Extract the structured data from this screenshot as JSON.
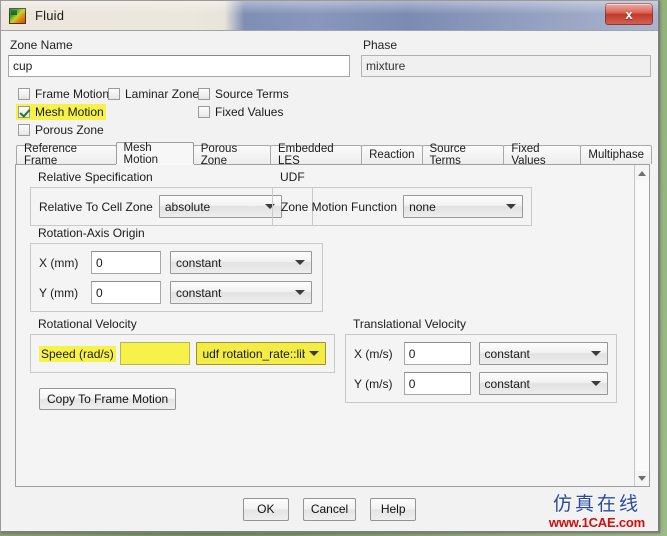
{
  "window": {
    "title": "Fluid",
    "icon": "fluent-app-icon",
    "close_label": "x"
  },
  "header": {
    "zone_name_label": "Zone Name",
    "zone_name_value": "cup",
    "phase_label": "Phase",
    "phase_value": "mixture"
  },
  "checkboxes": [
    {
      "label": "Frame Motion",
      "checked": false,
      "highlighted": false
    },
    {
      "label": "Laminar Zone",
      "checked": false,
      "highlighted": false
    },
    {
      "label": "Source Terms",
      "checked": false,
      "highlighted": false
    },
    {
      "label": "Mesh Motion",
      "checked": true,
      "highlighted": true
    },
    {
      "label": "Fixed Values",
      "checked": false,
      "highlighted": false
    },
    {
      "label": "Porous Zone",
      "checked": false,
      "highlighted": false
    }
  ],
  "tabs": [
    {
      "label": "Reference Frame",
      "active": false
    },
    {
      "label": "Mesh Motion",
      "active": true
    },
    {
      "label": "Porous Zone",
      "active": false
    },
    {
      "label": "Embedded LES",
      "active": false
    },
    {
      "label": "Reaction",
      "active": false
    },
    {
      "label": "Source Terms",
      "active": false
    },
    {
      "label": "Fixed Values",
      "active": false
    },
    {
      "label": "Multiphase",
      "active": false
    }
  ],
  "relative_specification": {
    "group_title": "Relative Specification",
    "cell_zone_label": "Relative To Cell Zone",
    "cell_zone_value": "absolute"
  },
  "udf": {
    "group_title": "UDF",
    "zone_motion_label": "Zone Motion Function",
    "zone_motion_value": "none"
  },
  "rotation_axis_origin": {
    "group_title": "Rotation-Axis Origin",
    "x_label": "X (mm)",
    "x_value": "0",
    "x_method": "constant",
    "y_label": "Y (mm)",
    "y_value": "0",
    "y_method": "constant"
  },
  "rotational_velocity": {
    "group_title": "Rotational Velocity",
    "speed_label": "Speed (rad/s)",
    "speed_value": "",
    "speed_method": "udf rotation_rate::libuc",
    "copy_button": "Copy To Frame Motion"
  },
  "translational_velocity": {
    "group_title": "Translational Velocity",
    "x_label": "X (m/s)",
    "x_value": "0",
    "x_method": "constant",
    "y_label": "Y (m/s)",
    "y_value": "0",
    "y_method": "constant"
  },
  "footer": {
    "ok": "OK",
    "cancel": "Cancel",
    "help": "Help"
  },
  "watermark": {
    "background_text": "1CAE.COM",
    "brand_cn": "仿真在线",
    "brand_url": "www.1CAE.com"
  },
  "colors": {
    "highlight": "#f7f24a",
    "close_red": "#c23a2a",
    "brand_blue": "#2a4a9c",
    "brand_red": "#d01010"
  }
}
